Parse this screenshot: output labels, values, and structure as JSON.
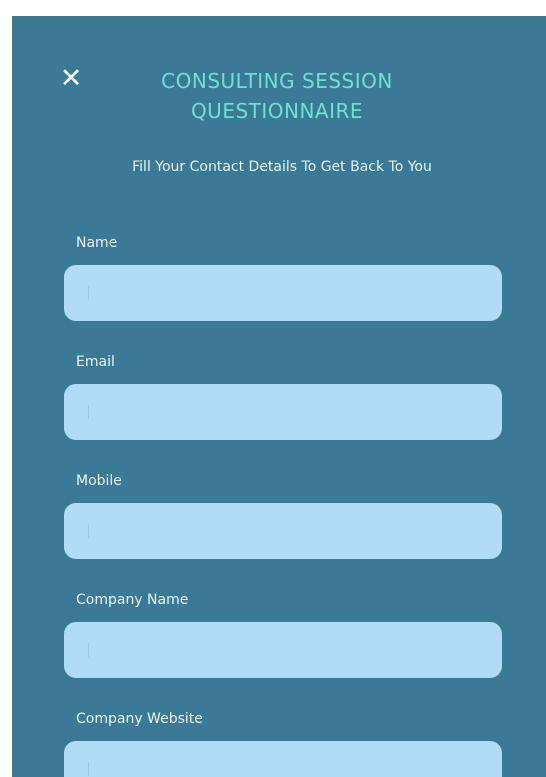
{
  "header": {
    "close_symbol": "✕",
    "close_icon": "close-icon",
    "title_line1": "CONSULTING SESSION",
    "title_line2": "QUESTIONNAIRE",
    "subtitle": "Fill Your Contact Details To Get Back To You"
  },
  "form": {
    "fields": [
      {
        "label": "Name",
        "value": "",
        "placeholder": ""
      },
      {
        "label": "Email",
        "value": "",
        "placeholder": ""
      },
      {
        "label": "Mobile",
        "value": "",
        "placeholder": ""
      },
      {
        "label": "Company Name",
        "value": "",
        "placeholder": ""
      },
      {
        "label": "Company Website",
        "value": "",
        "placeholder": ""
      }
    ]
  },
  "colors": {
    "panel_background": "#3a7a96",
    "title": "#6fe0d4",
    "input_background": "#b0dcf7",
    "label_text": "#eaf6f6"
  }
}
